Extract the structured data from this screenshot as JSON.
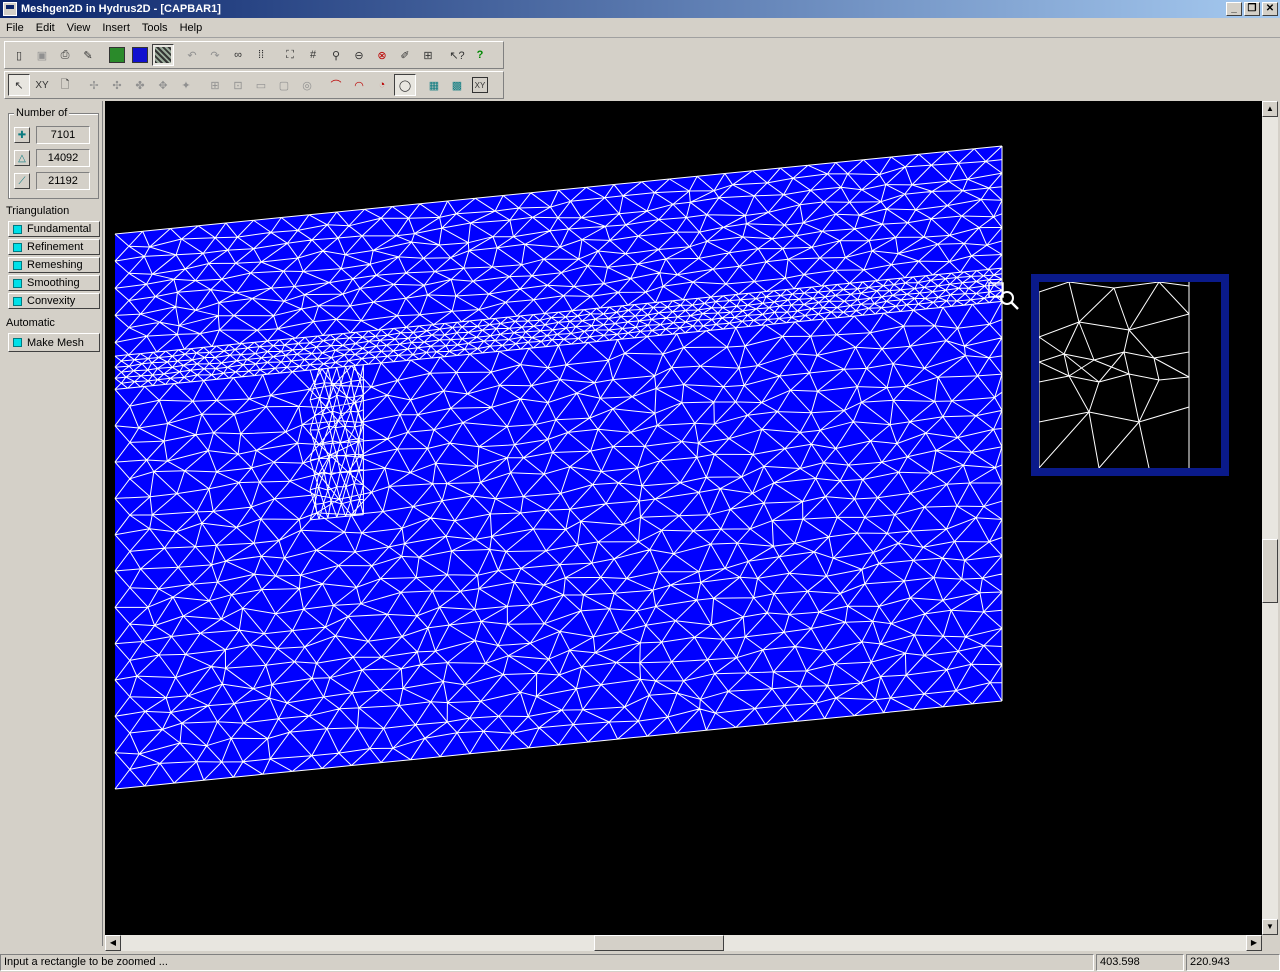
{
  "window": {
    "title": "Meshgen2D in Hydrus2D - [CAPBAR1]",
    "buttons": [
      "minimize",
      "restore",
      "close"
    ]
  },
  "menu": [
    "File",
    "Edit",
    "View",
    "Insert",
    "Tools",
    "Help"
  ],
  "toolbar1": [
    "door-icon",
    "save-icon",
    "print-icon",
    "pencil-icon",
    "mesh-green-icon",
    "mesh-blue-icon",
    "mesh-pattern-icon",
    "undo-icon",
    "redo-icon",
    "glasses-icon",
    "grid-dots-icon",
    "zoom-extents-icon",
    "grid-hash-icon",
    "zoom-icon",
    "zoom-out-icon",
    "zoom-cancel-icon",
    "pen-icon",
    "pan-icon",
    "help-pointer-icon",
    "help-icon"
  ],
  "toolbar2": [
    "arrow-icon",
    "xy-icon",
    "document-icon",
    "node-a-icon",
    "node-b-icon",
    "node-c-icon",
    "node-d-icon",
    "node-e-icon",
    "square-a-icon",
    "square-b-icon",
    "square-c-icon",
    "square-d-icon",
    "square-e-icon",
    "arc-a-icon",
    "arc-b-icon",
    "circle-icon",
    "circle-pressed-icon",
    "grid-a-icon",
    "grid-b-icon",
    "xy-grid-icon"
  ],
  "panel": {
    "number_of_label": "Number of",
    "counts": [
      {
        "icon": "node-icon",
        "value": "7101"
      },
      {
        "icon": "triangle-icon",
        "value": "14092"
      },
      {
        "icon": "edge-icon",
        "value": "21192"
      }
    ],
    "triangulation_label": "Triangulation",
    "triangulation_buttons": [
      "Fundamental",
      "Refinement",
      "Remeshing",
      "Smoothing",
      "Convexity"
    ],
    "automatic_label": "Automatic",
    "make_mesh_label": "Make Mesh"
  },
  "canvas": {
    "background": "#000000",
    "mesh_fill": "#0000ff",
    "mesh_line": "#ffffff"
  },
  "status": {
    "message": "Input a rectangle to be zoomed ...",
    "x": "403.598",
    "y": "220.943"
  }
}
